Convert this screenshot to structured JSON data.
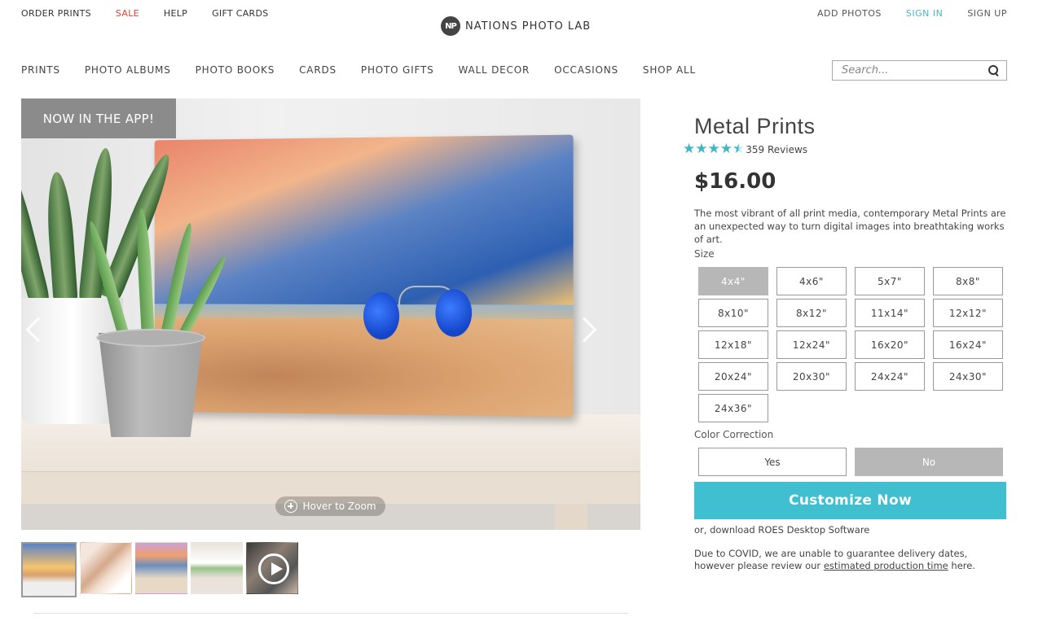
{
  "top_links": {
    "order_prints": "ORDER PRINTS",
    "sale": "SALE",
    "help": "HELP",
    "gift_cards": "GIFT CARDS"
  },
  "account_links": {
    "add_photos": "ADD PHOTOS",
    "sign_in": "SIGN IN",
    "sign_up": "SIGN UP"
  },
  "logo": {
    "mark": "NP",
    "text": "NATIONS PHOTO LAB"
  },
  "nav": [
    "PRINTS",
    "PHOTO ALBUMS",
    "PHOTO BOOKS",
    "CARDS",
    "PHOTO GIFTS",
    "WALL DECOR",
    "OCCASIONS",
    "SHOP ALL"
  ],
  "search": {
    "placeholder": "Search..."
  },
  "hero": {
    "badge": "NOW IN THE APP!",
    "zoom_label": "Hover to Zoom"
  },
  "product": {
    "title": "Metal Prints",
    "rating": 4.5,
    "reviews": "359 Reviews",
    "price": "$16.00",
    "description": "The most vibrant of all print media, contemporary Metal Prints are an unexpected way to turn digital images into breathtaking works of art.",
    "size_label": "Size",
    "sizes": [
      "4x4\"",
      "4x6\"",
      "5x7\"",
      "8x8\"",
      "8x10\"",
      "8x12\"",
      "11x14\"",
      "12x12\"",
      "12x18\"",
      "12x24\"",
      "16x20\"",
      "16x24\"",
      "20x24\"",
      "20x30\"",
      "24x24\"",
      "24x30\"",
      "24x36\""
    ],
    "selected_size": "4x4\"",
    "color_correction_label": "Color Correction",
    "color_correction_options": [
      "Yes",
      "No"
    ],
    "selected_color_correction": "No",
    "cta": "Customize Now",
    "roes": "or, download ROES Desktop Software",
    "covid_pre": "Due to COVID, we are unable to guarantee delivery dates, however please review our ",
    "covid_link": "estimated production time",
    "covid_post": " here."
  },
  "colors": {
    "accent": "#3fbfcf",
    "sale": "#d9432f",
    "selected": "#b7b7b7"
  }
}
